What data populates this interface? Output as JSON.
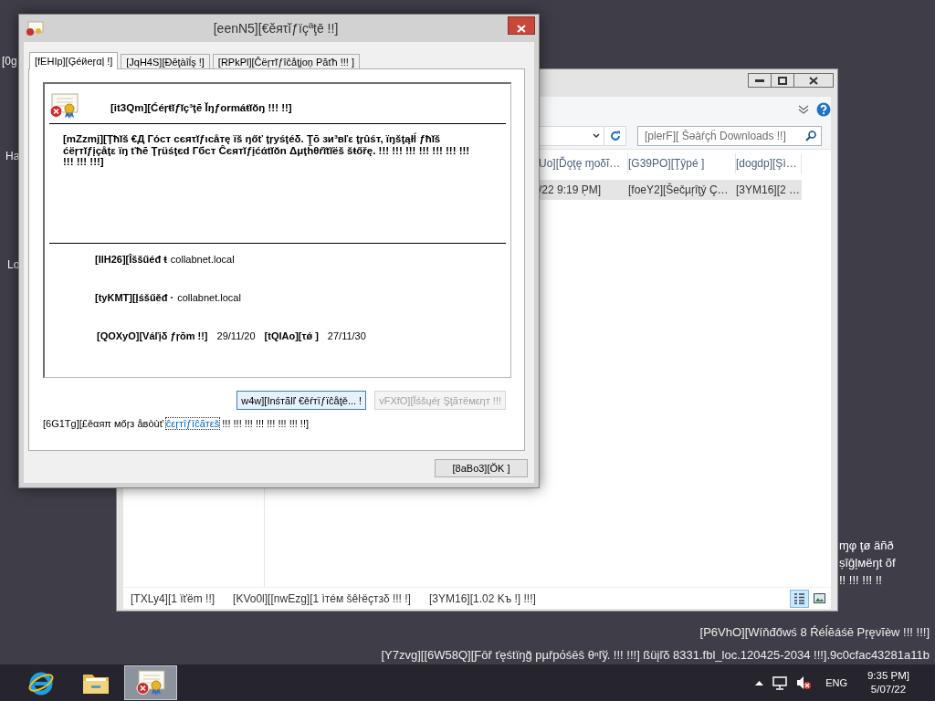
{
  "desktop": {
    "icon_labels": [
      "[0g",
      "Ha",
      "Lo"
    ],
    "side_text": [
      "ɱφ ţø äñð",
      "ṣîĝļмëŋt õf",
      "!! !!! !!! !!"
    ],
    "build_info": [
      "[P6VhO][Wíňđőwś 8 Ŕéĺĕáśē Pŗęνĩèw !!! !!!]",
      "[Y7zvg][[6W58Q][Ƒōř ťęśtïŋğ pµřpόśēŝ θⁿľў. !!! !!!] ßüįľδ 8331.fbl_loc.120425-2034 !!!].9c0cfac43281a11b"
    ]
  },
  "explorer": {
    "search": {
      "placeholder": "[plerF][ Šǝàŕçĥ Downloads !!]"
    },
    "columns": [
      "Uo][Ďǫţę ɱοδĩ…",
      "[G39PO][Ţŷpé ]",
      "[dogdp][Şì…"
    ],
    "rows": [
      {
        "cells": [
          "/22 9:19 P̣M]",
          "[foeY2][Šečµŗîţý Ç…",
          "[3YM16][2 …"
        ],
        "selected": true
      }
    ],
    "status": [
      "[TXLy4][1 ïťëm !!]",
      "[KVo0l][[nwEzg][1 ìтéм šêŀëçтзδ !!! !]",
      "[3YM16][1.02 Kъ !] !!!]"
    ],
    "views": [
      {
        "kind": "details",
        "selected": true
      },
      {
        "kind": "tiles",
        "selected": false
      }
    ]
  },
  "dialog": {
    "title": "[eenN5][€ĕяτĭƒïçªţē !!]",
    "tabs": [
      {
        "label": "[fEHIp][Ģéйeŗαļ !]",
        "selected": true
      },
      {
        "label": "[JqH4S][Ðēţàîĺş !]",
        "selected": false
      },
      {
        "label": "[RPkPl][Ĉëŗтĭƒîĉåţįοņ Păťħ !!! ]",
        "selected": false
      }
    ],
    "heading": "[it3Qm][Ćéŗŧĭƒĭç³ţē Ĭŋƒormáŧĭŏŋ !!! !!]",
    "message": "[mZzmj][Ţħĭš €Д Гόст cєяτĭƒιcåтę ïš ŋőť ţŗyśţéδ. Ţō зи³вľε ţŗûśт, ïŋšţąłĺ ƒħĭš ćëŗтĭƒįçåţε ïŋ ťħē Ţŗüśţєd Гбст Ĉєятĭƒįćάtĭŏn Δμţĥθŕĩtĩёš šŧőřę. !!! !!! !!! !!! !!! !!! !!! !!! !!! !!!]",
    "fields": [
      {
        "label": "[IlH26][Îššűéđ ŧ",
        "value": "collabnet.local"
      },
      {
        "label": "[tyKMT][Įśšűěđ ·",
        "value": "collabnet.local"
      }
    ],
    "validity": {
      "from_label": "[QOXyO][Váľįδ ƒŗōm !!]",
      "from": "29/11/20",
      "to_label": "[tQIAo][τǿ ]",
      "to": "27/11/30"
    },
    "buttons": [
      {
        "label": "w4w][Ιnśтãlľ €ěŕтïƒïĉåţě... !",
        "disabled": false,
        "focused": true
      },
      {
        "label": "vFXfO][Ĭśšųéŗ Şţãтëмεηт !!!",
        "disabled": true,
        "focused": false
      }
    ],
    "learn_more": {
      "before": "[6G1Tg][£ěαяπ мőŗз åвòùť ",
      "link": "ĉεŗтîƒîĉãтεš",
      "after": " !!! !!! !!! !!! !!! !!! !!! !!]"
    },
    "ok": "[8aBo3][ŎK ]"
  },
  "taskbar": {
    "apps": [
      {
        "kind": "browser",
        "active": false
      },
      {
        "kind": "folder",
        "active": false
      },
      {
        "kind": "certificate",
        "active": true
      }
    ],
    "language": "ENG",
    "time": "9:35 P̣M]",
    "date": "5/07/22"
  }
}
